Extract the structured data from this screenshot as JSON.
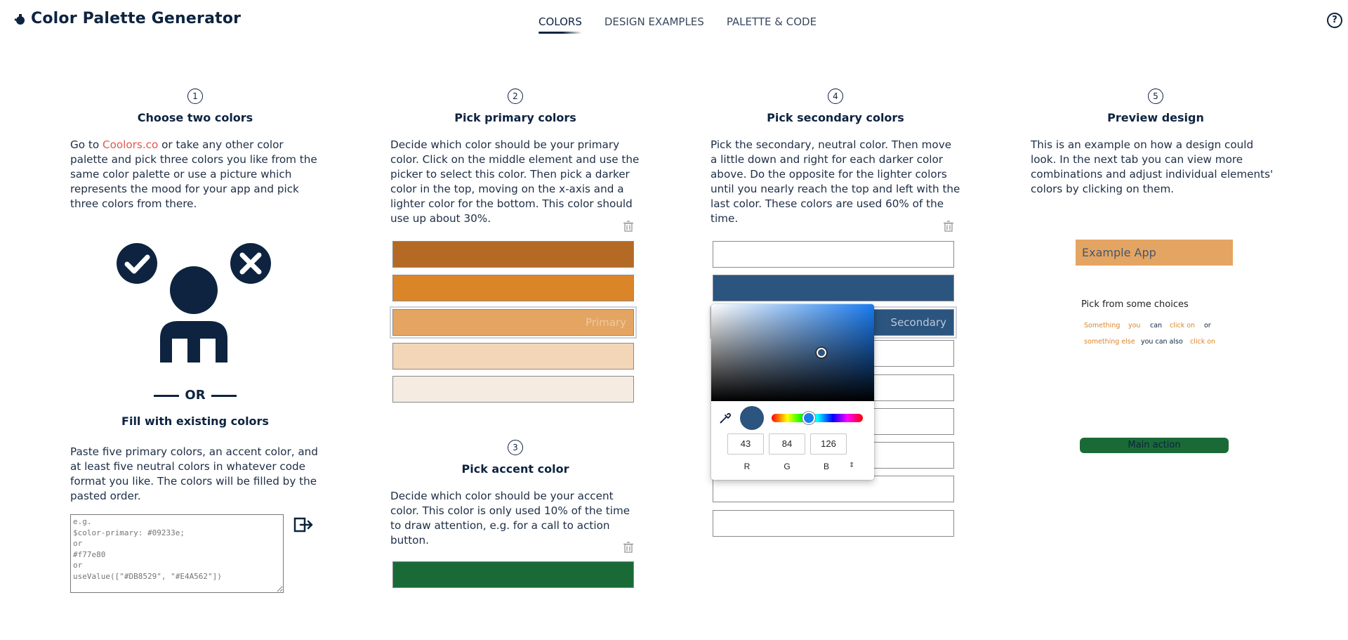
{
  "header": {
    "app_title": "Color Palette Generator",
    "tabs": [
      "COLORS",
      "DESIGN EXAMPLES",
      "PALETTE & CODE"
    ],
    "active_tab": "COLORS",
    "help_icon": "question-circle-icon"
  },
  "col1": {
    "step": "1",
    "title": "Choose two colors",
    "desc_prefix": "Go to ",
    "desc_link": "Coolors.co",
    "desc_suffix": " or take any other color palette and pick three colors you like from the same color palette or use a picture which represents the mood for your app and pick three colors from there.",
    "or_text": "OR",
    "fill_title": "Fill with existing colors",
    "fill_desc": "Paste five primary colors, an accent color, and at least five neutral colors in whatever code format you like. The colors will be filled by the pasted order.",
    "textarea_placeholder": "e.g.\n$color-primary: #09233e;\nor\n#f77e80\nor\nuseValue([\"#DB8529\", \"#E4A562\"])"
  },
  "col2": {
    "step": "2",
    "title": "Pick primary colors",
    "desc": "Decide which color should be your primary color. Click on the middle element and use the picker to select this color. Then pick a darker color in the top, moving on the x-axis and a lighter color for the bottom. This color should use up about 30%.",
    "swatches": [
      "#b46a24",
      "#db8529",
      "#e4a562",
      "#f3d5b8",
      "#f5ebe1"
    ],
    "selected_label": "Primary",
    "accent_step": "3",
    "accent_title": "Pick accent color",
    "accent_desc": "Decide which color should be your accent color. This color is only used 10% of the time to draw attention, e.g. for a call to action button.",
    "accent_color": "#1a6a38"
  },
  "col3": {
    "step": "4",
    "title": "Pick secondary colors",
    "desc": "Pick the secondary, neutral color. Then move a little down and right for each darker color above. Do the opposite for the lighter colors until you nearly reach the top and left with the last color. These colors are used 60% of the time.",
    "swatches": [
      "#ffffff",
      "#2b547e",
      "#2b547e",
      "#ffffff",
      "#ffffff",
      "#ffffff",
      "#ffffff",
      "#ffffff",
      "#ffffff"
    ],
    "selected_label": "Secondary"
  },
  "picker": {
    "r": "43",
    "g": "84",
    "b": "126",
    "r_label": "R",
    "g_label": "G",
    "b_label": "B",
    "mode_toggle": "⇕"
  },
  "col4": {
    "step": "5",
    "title": "Preview design",
    "desc": "This is an example on how a design could look. In the next tab you can view more combinations and adjust individual elements' colors by clicking on them.",
    "app_title": "Example App",
    "choices_text": "Pick from some choices",
    "chips_row1": [
      "Something",
      "you",
      "can",
      "click on",
      "or"
    ],
    "chips_row2": [
      "something else",
      "you can also",
      "click on"
    ],
    "main_action": "Main action"
  }
}
